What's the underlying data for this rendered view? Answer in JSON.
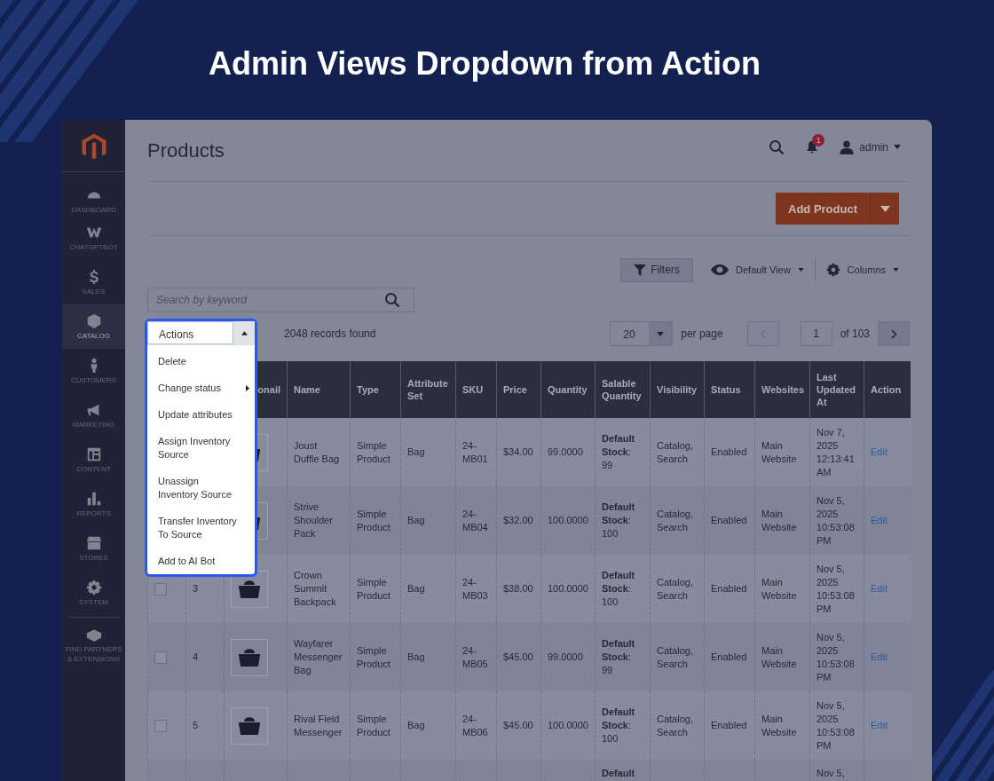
{
  "headline": "Admin Views Dropdown from Action",
  "sidebar": {
    "items": [
      {
        "label": "DASHBOARD",
        "selected": false
      },
      {
        "label": "CHATGPTBOT",
        "selected": false
      },
      {
        "label": "SALES",
        "selected": false
      },
      {
        "label": "CATALOG",
        "selected": true
      },
      {
        "label": "CUSTOMERS",
        "selected": false
      },
      {
        "label": "MARKETING",
        "selected": false
      },
      {
        "label": "CONTENT",
        "selected": false
      },
      {
        "label": "REPORTS",
        "selected": false
      },
      {
        "label": "STORES",
        "selected": false
      },
      {
        "label": "SYSTEM",
        "selected": false
      },
      {
        "label": "FIND PARTNERS & EXTENSIONS",
        "selected": false
      }
    ]
  },
  "header": {
    "title": "Products",
    "notification_count": "1",
    "user": "admin"
  },
  "add_button": {
    "label": "Add Product"
  },
  "toolbar": {
    "filters": "Filters",
    "view": "Default View",
    "columns": "Columns"
  },
  "search": {
    "placeholder": "Search by keyword"
  },
  "actions_select": {
    "label": "Actions",
    "expanded": true,
    "options": [
      {
        "label": "Delete",
        "has_submenu": false
      },
      {
        "label": "Change status",
        "has_submenu": true
      },
      {
        "label": "Update attributes",
        "has_submenu": false
      },
      {
        "label": "Assign Inventory Source",
        "has_submenu": false
      },
      {
        "label": "Unassign Inventory Source",
        "has_submenu": false
      },
      {
        "label": "Transfer Inventory To Source",
        "has_submenu": false
      },
      {
        "label": "Add to AI Bot",
        "has_submenu": false
      }
    ]
  },
  "records": "2048 records found",
  "pagination": {
    "per_page": "20",
    "per_page_label": "per page",
    "prev_disabled": true,
    "page": "1",
    "of": "of 103"
  },
  "table": {
    "columns": [
      "onail",
      "Name",
      "Type",
      "Attribute Set",
      "SKU",
      "Price",
      "Quantity",
      "Salable Quantity",
      "Visibility",
      "Status",
      "Websites",
      "Last Updated At",
      "Action"
    ],
    "rows": [
      {
        "name": "Joust Duffle Bag",
        "type": "Simple Product",
        "attribute_set": "Bag",
        "sku": "24-MB01",
        "price": "$34.00",
        "quantity": "99.0000",
        "salable": "**Default Stock**: 99",
        "visibility": "Catalog, Search",
        "status": "Enabled",
        "websites": "Main Website",
        "updated": "Nov 7, 2025 12:13:41 AM",
        "action": "Edit"
      },
      {
        "name": "Strive Shoulder Pack",
        "type": "Simple Product",
        "attribute_set": "Bag",
        "sku": "24-MB04",
        "price": "$32.00",
        "quantity": "100.0000",
        "salable": "**Default Stock**: 100",
        "visibility": "Catalog, Search",
        "status": "Enabled",
        "websites": "Main Website",
        "updated": "Nov 5, 2025 10:53:08 PM",
        "action": "Edit"
      },
      {
        "checked": false,
        "id": "3",
        "name": "Crown Summit Backpack",
        "type": "Simple Product",
        "attribute_set": "Bag",
        "sku": "24-MB03",
        "price": "$38.00",
        "quantity": "100.0000",
        "salable": "**Default Stock**: 100",
        "visibility": "Catalog, Search",
        "status": "Enabled",
        "websites": "Main Website",
        "updated": "Nov 5, 2025 10:53:08 PM",
        "action": "Edit"
      },
      {
        "checked": false,
        "id": "4",
        "name": "Wayfarer Messenger Bag",
        "type": "Simple Product",
        "attribute_set": "Bag",
        "sku": "24-MB05",
        "price": "$45.00",
        "quantity": "99.0000",
        "salable": "**Default Stock**: 99",
        "visibility": "Catalog, Search",
        "status": "Enabled",
        "websites": "Main Website",
        "updated": "Nov 5, 2025 10:53:08 PM",
        "action": "Edit"
      },
      {
        "checked": false,
        "id": "5",
        "name": "Rival Field Messenger",
        "type": "Simple Product",
        "attribute_set": "Bag",
        "sku": "24-MB06",
        "price": "$45.00",
        "quantity": "100.0000",
        "salable": "**Default Stock**: 100",
        "visibility": "Catalog, Search",
        "status": "Enabled",
        "websites": "Main Website",
        "updated": "Nov 5, 2025 10:53:08 PM",
        "action": "Edit"
      },
      {
        "salable": "**Default**",
        "updated": "Nov 5,"
      }
    ]
  }
}
